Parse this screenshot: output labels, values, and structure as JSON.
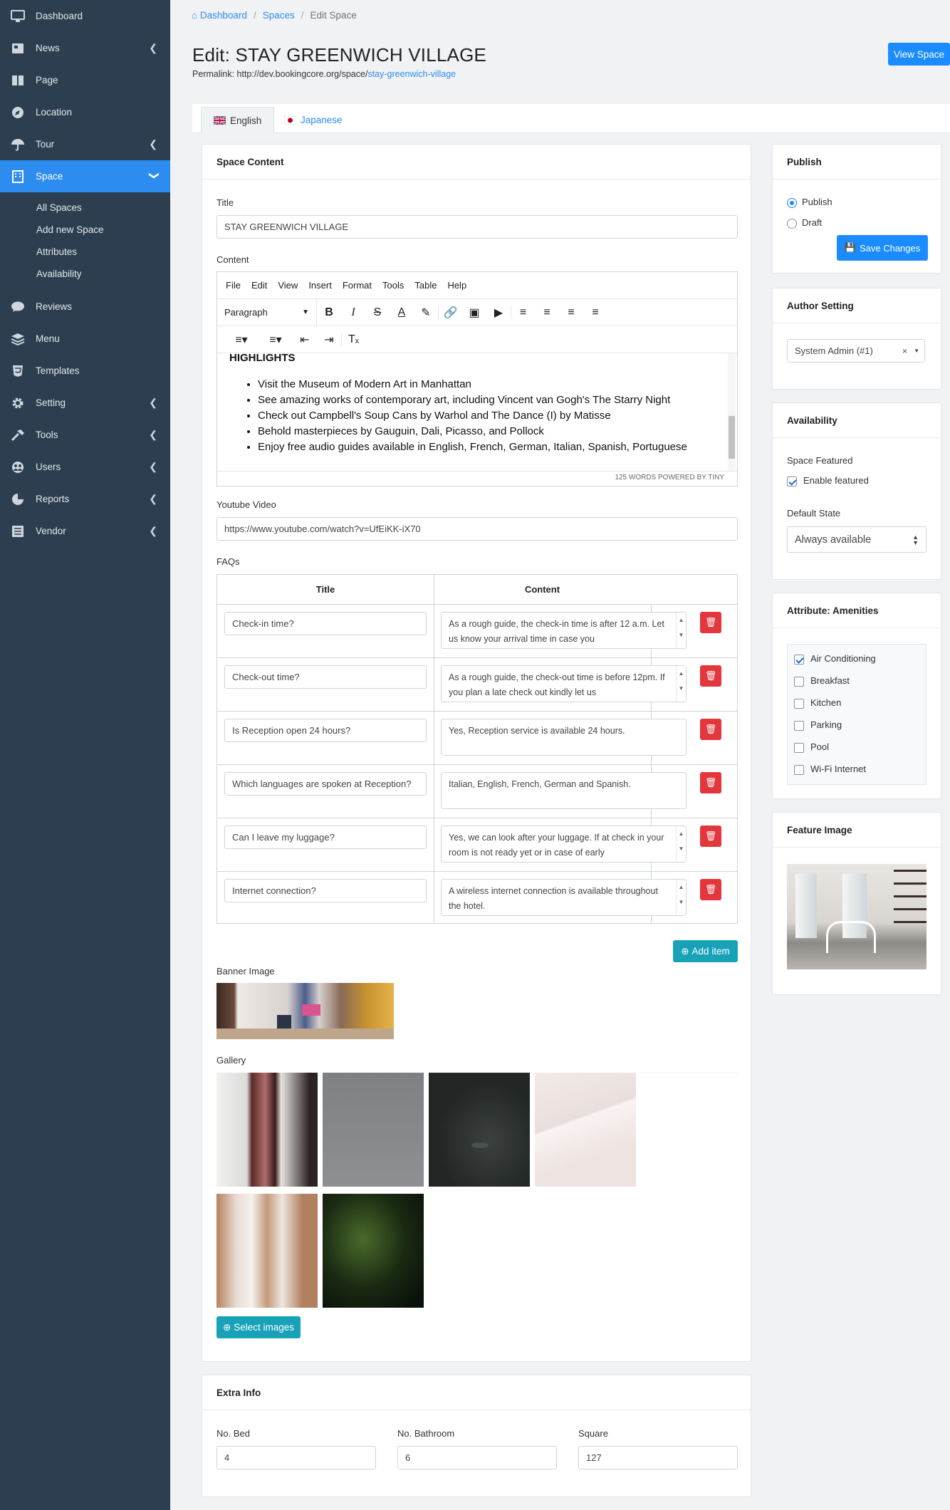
{
  "sidebar": {
    "items": [
      {
        "label": "Dashboard",
        "icon": "monitor-icon"
      },
      {
        "label": "News",
        "icon": "newspaper-icon",
        "chevron": true
      },
      {
        "label": "Page",
        "icon": "book-icon"
      },
      {
        "label": "Location",
        "icon": "compass-icon"
      },
      {
        "label": "Tour",
        "icon": "umbrella-icon",
        "chevron": true
      },
      {
        "label": "Space",
        "icon": "building-icon",
        "active": true
      },
      {
        "label": "Reviews",
        "icon": "comment-icon"
      },
      {
        "label": "Menu",
        "icon": "layers-icon"
      },
      {
        "label": "Templates",
        "icon": "html5-icon"
      },
      {
        "label": "Setting",
        "icon": "gear-icon",
        "chevron": true
      },
      {
        "label": "Tools",
        "icon": "hammer-icon",
        "chevron": true
      },
      {
        "label": "Users",
        "icon": "users-icon",
        "chevron": true
      },
      {
        "label": "Reports",
        "icon": "pie-chart-icon",
        "chevron": true
      },
      {
        "label": "Vendor",
        "icon": "list-icon",
        "chevron": true
      }
    ],
    "space_sub": [
      "All Spaces",
      "Add new Space",
      "Attributes",
      "Availability"
    ]
  },
  "breadcrumb": {
    "home": "Dashboard",
    "spaces": "Spaces",
    "current": "Edit Space"
  },
  "page": {
    "title": "Edit: STAY GREENWICH VILLAGE",
    "permalink_label": "Permalink: http://dev.bookingcore.org/space/",
    "permalink_slug": "stay-greenwich-village",
    "view_button": "View Space"
  },
  "tabs": {
    "english": "English",
    "japanese": "Japanese"
  },
  "content": {
    "card_title": "Space Content",
    "title_label": "Title",
    "title_value": "STAY GREENWICH VILLAGE",
    "content_label": "Content",
    "editor_menu": [
      "File",
      "Edit",
      "View",
      "Insert",
      "Format",
      "Tools",
      "Table",
      "Help"
    ],
    "paragraph_select": "Paragraph",
    "editor_heading": "HIGHLIGHTS",
    "editor_items": [
      "Visit the Museum of Modern Art in Manhattan",
      "See amazing works of contemporary art, including Vincent van Gogh's The Starry Night",
      "Check out Campbell's Soup Cans by Warhol and The Dance (I) by Matisse",
      "Behold masterpieces by Gauguin, Dali, Picasso, and Pollock",
      "Enjoy free audio guides available in English, French, German, Italian, Spanish, Portuguese"
    ],
    "editor_status": "125 WORDS  POWERED BY TINY",
    "youtube_label": "Youtube Video",
    "youtube_value": "https://www.youtube.com/watch?v=UfEiKK-iX70",
    "faqs_label": "FAQs",
    "faq_col_title": "Title",
    "faq_col_content": "Content",
    "faqs": [
      {
        "title": "Check-in time?",
        "content": "As a rough guide, the check-in time is after 12 a.m. Let us know your arrival time in case you"
      },
      {
        "title": "Check-out time?",
        "content": "As a rough guide, the check-out time is before 12pm. If you plan a late check out kindly let us"
      },
      {
        "title": "Is Reception open 24 hours?",
        "content": "Yes, Reception service is available 24 hours."
      },
      {
        "title": "Which languages are spoken at Reception?",
        "content": "Italian, English, French, German and Spanish."
      },
      {
        "title": "Can I leave my luggage?",
        "content": "Yes, we can look after your luggage. If at check in your room is not ready yet or in case of early"
      },
      {
        "title": "Internet connection?",
        "content": "A wireless internet connection is available throughout the hotel."
      }
    ],
    "add_item": "Add item",
    "banner_label": "Banner Image",
    "gallery_label": "Gallery",
    "select_images": "Select images"
  },
  "extra": {
    "card_title": "Extra Info",
    "bed_label": "No. Bed",
    "bed_value": "4",
    "bath_label": "No. Bathroom",
    "bath_value": "6",
    "square_label": "Square",
    "square_value": "127"
  },
  "publish": {
    "card_title": "Publish",
    "publish_option": "Publish",
    "draft_option": "Draft",
    "save_button": "Save Changes"
  },
  "author": {
    "card_title": "Author Setting",
    "value": "System Admin (#1)"
  },
  "availability": {
    "card_title": "Availability",
    "featured_label": "Space Featured",
    "featured_checkbox": "Enable featured",
    "default_state_label": "Default State",
    "default_state_value": "Always available"
  },
  "amenities": {
    "card_title": "Attribute: Amenities",
    "items": [
      {
        "label": "Air Conditioning",
        "checked": true
      },
      {
        "label": "Breakfast",
        "checked": false
      },
      {
        "label": "Kitchen",
        "checked": false
      },
      {
        "label": "Parking",
        "checked": false
      },
      {
        "label": "Pool",
        "checked": false
      },
      {
        "label": "Wi-Fi Internet",
        "checked": false
      }
    ]
  },
  "feature_image": {
    "card_title": "Feature Image"
  },
  "colors": {
    "sidebar": "#2c3e50",
    "active": "#2d8cf0",
    "primary": "#1a8cff",
    "info": "#17a2b8",
    "danger": "#e4363d"
  }
}
